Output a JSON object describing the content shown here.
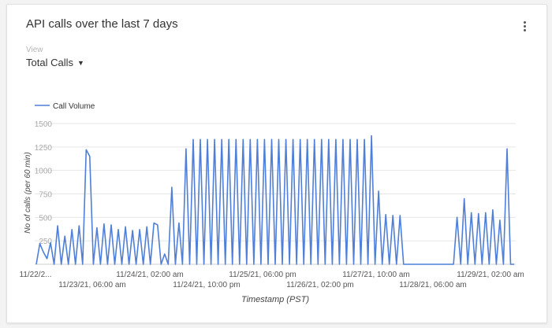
{
  "card": {
    "title": "API calls over the last 7 days",
    "menu_icon": "kebab-vertical-icon"
  },
  "view": {
    "label": "View",
    "selected": "Total Calls",
    "caret_icon": "caret-down-icon"
  },
  "colors": {
    "series": "#4f7fd8",
    "grid": "#e6e6e6",
    "axis_text": "#555555",
    "y_text": "#aaaaaa"
  },
  "chart_data": {
    "type": "line",
    "xlabel": "Timestamp (PST)",
    "ylabel": "No of calls (per 60 min)",
    "ylim": [
      0,
      1500
    ],
    "yticks": [
      "1500",
      "1250",
      "1000",
      "750",
      "500",
      "250"
    ],
    "xticks": [
      "11/22/2...",
      "11/23/21, 06:00 am",
      "11/24/21, 02:00 am",
      "11/24/21, 10:00 pm",
      "11/25/21, 06:00 pm",
      "11/26/21, 02:00 pm",
      "11/27/21, 10:00 am",
      "11/28/21, 06:00 am",
      "11/29/21, 02:00 am"
    ],
    "grid": true,
    "legend": "top-left",
    "series": [
      {
        "name": "Call Volume",
        "values": [
          0,
          220,
          130,
          60,
          230,
          0,
          410,
          0,
          300,
          0,
          370,
          0,
          410,
          0,
          1220,
          1150,
          0,
          390,
          0,
          430,
          0,
          420,
          0,
          370,
          0,
          400,
          0,
          360,
          0,
          370,
          0,
          400,
          0,
          440,
          420,
          0,
          110,
          0,
          820,
          0,
          440,
          0,
          1230,
          0,
          1330,
          0,
          1330,
          0,
          1330,
          0,
          1330,
          0,
          1330,
          0,
          1330,
          0,
          1330,
          0,
          1330,
          0,
          1330,
          0,
          1330,
          0,
          1330,
          0,
          1330,
          0,
          1330,
          0,
          1330,
          0,
          1330,
          0,
          1330,
          0,
          1330,
          0,
          1330,
          0,
          1330,
          0,
          1330,
          0,
          1330,
          0,
          1330,
          0,
          1330,
          0,
          1330,
          0,
          1330,
          0,
          1370,
          0,
          780,
          0,
          530,
          0,
          520,
          0,
          520,
          0,
          0,
          0,
          0,
          0,
          0,
          0,
          0,
          0,
          0,
          0,
          0,
          0,
          0,
          0,
          500,
          0,
          700,
          0,
          550,
          0,
          540,
          0,
          550,
          0,
          580,
          0,
          470,
          0,
          1230,
          0,
          0
        ]
      }
    ]
  }
}
